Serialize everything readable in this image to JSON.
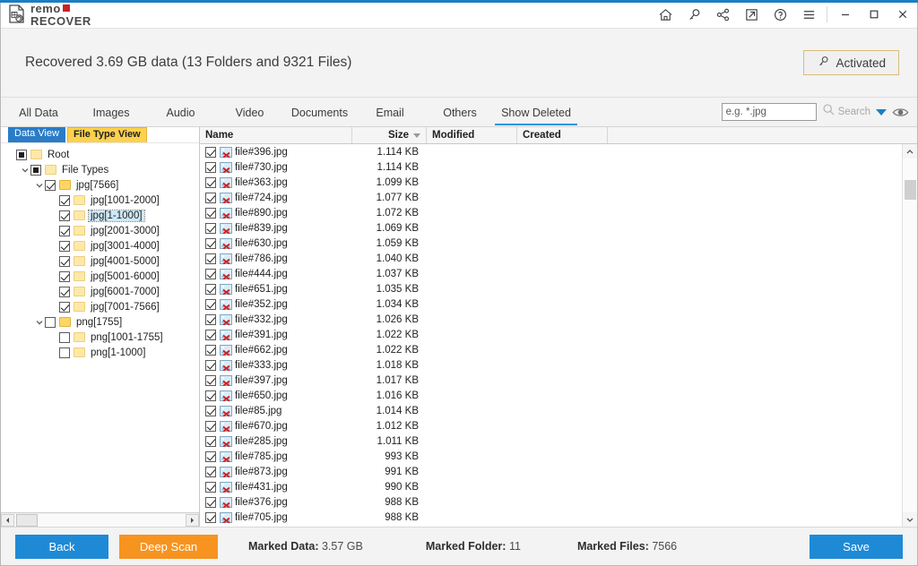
{
  "window": {
    "logo_top": "remo",
    "logo_bottom": "RECOVER",
    "icons": [
      "home-icon",
      "key-icon",
      "share-icon",
      "external-link-icon",
      "help-icon",
      "menu-icon"
    ],
    "minimize": "–",
    "maximize": "□",
    "close": "✕"
  },
  "banner": {
    "title": "Recovered 3.69 GB data (13 Folders and 9321 Files)",
    "activated_label": "Activated"
  },
  "tabs": {
    "items": [
      {
        "label": "All Data",
        "active": false
      },
      {
        "label": "Images",
        "active": false
      },
      {
        "label": "Audio",
        "active": false
      },
      {
        "label": "Video",
        "active": false
      },
      {
        "label": "Documents",
        "active": false
      },
      {
        "label": "Email",
        "active": false
      },
      {
        "label": "Others",
        "active": false
      },
      {
        "label": "Show Deleted",
        "active": true
      }
    ],
    "search_placeholder": "e.g. *.jpg",
    "search_value": "",
    "search_label": "Search"
  },
  "left_panel": {
    "view_tabs": [
      {
        "label": "Data View",
        "style": "blue"
      },
      {
        "label": "File Type View",
        "style": "gold"
      }
    ],
    "tree": [
      {
        "label": "Root",
        "indent": 0,
        "twist": "",
        "check": "partial",
        "folder": "pale",
        "selected": false
      },
      {
        "label": "File Types",
        "indent": 1,
        "twist": "down",
        "check": "partial",
        "folder": "pale",
        "selected": false
      },
      {
        "label": "jpg[7566]",
        "indent": 2,
        "twist": "down",
        "check": "checked",
        "folder": "full",
        "selected": false
      },
      {
        "label": "jpg[1001-2000]",
        "indent": 3,
        "twist": "",
        "check": "checked",
        "folder": "pale",
        "selected": false
      },
      {
        "label": "jpg[1-1000]",
        "indent": 3,
        "twist": "",
        "check": "checked",
        "folder": "pale",
        "selected": true
      },
      {
        "label": "jpg[2001-3000]",
        "indent": 3,
        "twist": "",
        "check": "checked",
        "folder": "pale",
        "selected": false
      },
      {
        "label": "jpg[3001-4000]",
        "indent": 3,
        "twist": "",
        "check": "checked",
        "folder": "pale",
        "selected": false
      },
      {
        "label": "jpg[4001-5000]",
        "indent": 3,
        "twist": "",
        "check": "checked",
        "folder": "pale",
        "selected": false
      },
      {
        "label": "jpg[5001-6000]",
        "indent": 3,
        "twist": "",
        "check": "checked",
        "folder": "pale",
        "selected": false
      },
      {
        "label": "jpg[6001-7000]",
        "indent": 3,
        "twist": "",
        "check": "checked",
        "folder": "pale",
        "selected": false
      },
      {
        "label": "jpg[7001-7566]",
        "indent": 3,
        "twist": "",
        "check": "checked",
        "folder": "pale",
        "selected": false
      },
      {
        "label": "png[1755]",
        "indent": 2,
        "twist": "down",
        "check": "",
        "folder": "full",
        "selected": false
      },
      {
        "label": "png[1001-1755]",
        "indent": 3,
        "twist": "",
        "check": "",
        "folder": "pale",
        "selected": false
      },
      {
        "label": "png[1-1000]",
        "indent": 3,
        "twist": "",
        "check": "",
        "folder": "pale",
        "selected": false
      }
    ]
  },
  "file_list": {
    "columns": [
      "Name",
      "Size",
      "Modified",
      "Created"
    ],
    "sort_column": "Size",
    "sort_direction": "descending",
    "rows": [
      {
        "name": "file#396.jpg",
        "size": "1.114 KB",
        "modified": "",
        "created": "",
        "checked": true
      },
      {
        "name": "file#730.jpg",
        "size": "1.114 KB",
        "modified": "",
        "created": "",
        "checked": true
      },
      {
        "name": "file#363.jpg",
        "size": "1.099 KB",
        "modified": "",
        "created": "",
        "checked": true
      },
      {
        "name": "file#724.jpg",
        "size": "1.077 KB",
        "modified": "",
        "created": "",
        "checked": true
      },
      {
        "name": "file#890.jpg",
        "size": "1.072 KB",
        "modified": "",
        "created": "",
        "checked": true
      },
      {
        "name": "file#839.jpg",
        "size": "1.069 KB",
        "modified": "",
        "created": "",
        "checked": true
      },
      {
        "name": "file#630.jpg",
        "size": "1.059 KB",
        "modified": "",
        "created": "",
        "checked": true
      },
      {
        "name": "file#786.jpg",
        "size": "1.040 KB",
        "modified": "",
        "created": "",
        "checked": true
      },
      {
        "name": "file#444.jpg",
        "size": "1.037 KB",
        "modified": "",
        "created": "",
        "checked": true
      },
      {
        "name": "file#651.jpg",
        "size": "1.035 KB",
        "modified": "",
        "created": "",
        "checked": true
      },
      {
        "name": "file#352.jpg",
        "size": "1.034 KB",
        "modified": "",
        "created": "",
        "checked": true
      },
      {
        "name": "file#332.jpg",
        "size": "1.026 KB",
        "modified": "",
        "created": "",
        "checked": true
      },
      {
        "name": "file#391.jpg",
        "size": "1.022 KB",
        "modified": "",
        "created": "",
        "checked": true
      },
      {
        "name": "file#662.jpg",
        "size": "1.022 KB",
        "modified": "",
        "created": "",
        "checked": true
      },
      {
        "name": "file#333.jpg",
        "size": "1.018 KB",
        "modified": "",
        "created": "",
        "checked": true
      },
      {
        "name": "file#397.jpg",
        "size": "1.017 KB",
        "modified": "",
        "created": "",
        "checked": true
      },
      {
        "name": "file#650.jpg",
        "size": "1.016 KB",
        "modified": "",
        "created": "",
        "checked": true
      },
      {
        "name": "file#85.jpg",
        "size": "1.014 KB",
        "modified": "",
        "created": "",
        "checked": true
      },
      {
        "name": "file#670.jpg",
        "size": "1.012 KB",
        "modified": "",
        "created": "",
        "checked": true
      },
      {
        "name": "file#285.jpg",
        "size": "1.011 KB",
        "modified": "",
        "created": "",
        "checked": true
      },
      {
        "name": "file#785.jpg",
        "size": "993 KB",
        "modified": "",
        "created": "",
        "checked": true
      },
      {
        "name": "file#873.jpg",
        "size": "991 KB",
        "modified": "",
        "created": "",
        "checked": true
      },
      {
        "name": "file#431.jpg",
        "size": "990 KB",
        "modified": "",
        "created": "",
        "checked": true
      },
      {
        "name": "file#376.jpg",
        "size": "988 KB",
        "modified": "",
        "created": "",
        "checked": true
      },
      {
        "name": "file#705.jpg",
        "size": "988 KB",
        "modified": "",
        "created": "",
        "checked": true
      }
    ]
  },
  "footer": {
    "back_label": "Back",
    "deep_scan_label": "Deep Scan",
    "marked_data_label": "Marked Data:",
    "marked_data_value": "3.57 GB",
    "marked_folder_label": "Marked Folder:",
    "marked_folder_value": "11",
    "marked_files_label": "Marked Files:",
    "marked_files_value": "7566",
    "save_label": "Save"
  },
  "colors": {
    "accent_blue": "#1e8ad6",
    "titlebar_blue": "#1b7fc4",
    "orange": "#f79420",
    "gold_tab": "#fdd14e",
    "logo_red": "#cc2222"
  }
}
